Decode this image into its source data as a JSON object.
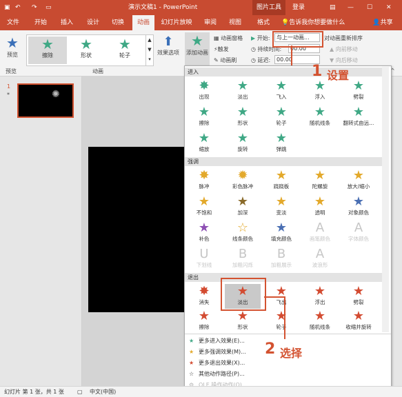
{
  "titlebar": {
    "title": "演示文稿1 - PowerPoint",
    "context": "图片工具",
    "login": "登录"
  },
  "tabs": [
    "文件",
    "开始",
    "插入",
    "设计",
    "切换",
    "动画",
    "幻灯片放映",
    "审阅",
    "视图",
    "格式"
  ],
  "tell_me": "告诉我你想要做什么",
  "share": "共享",
  "ribbon": {
    "preview": "预览",
    "preview_group": "预览",
    "gallery": [
      "擦除",
      "形状",
      "轮子"
    ],
    "effect_options": "效果选项",
    "animation_group": "动画",
    "add_animation": "添加动画",
    "anim_pane": "动画窗格",
    "trigger": "触发",
    "anim_painter": "动画刷",
    "start_label": "开始:",
    "start_value": "与上一动画...",
    "duration_label": "持续时间:",
    "duration_value": "00.00",
    "delay_label": "延迟:",
    "delay_value": "00.00",
    "reorder": "对动画重新排序",
    "move_earlier": "向前移动",
    "move_later": "向后移动"
  },
  "thumb": {
    "number": "1",
    "mark": "*"
  },
  "sections": {
    "enter": "进入",
    "emph": "强调",
    "exit": "退出"
  },
  "enter": [
    "出现",
    "淡出",
    "飞入",
    "浮入",
    "劈裂",
    "擦除",
    "形状",
    "轮子",
    "随机线条",
    "翻转式由远...",
    "缩放",
    "旋转",
    "弹跳"
  ],
  "emph": [
    "脉冲",
    "彩色脉冲",
    "跷跷板",
    "陀螺旋",
    "放大/缩小",
    "不饱和",
    "加深",
    "变淡",
    "透明",
    "对象颜色",
    "补色",
    "线条颜色",
    "填充颜色",
    "画笔颜色",
    "字体颜色",
    "下划线",
    "加粗闪烁",
    "加粗展示",
    "波浪形"
  ],
  "exit": [
    "消失",
    "淡出",
    "飞出",
    "浮出",
    "劈裂",
    "擦除",
    "形状",
    "轮子",
    "随机线条",
    "收缩并旋转"
  ],
  "more": [
    "更多进入效果(E)...",
    "更多强调效果(M)...",
    "更多退出效果(X)...",
    "其他动作路径(P)...",
    "OLE 操作动作(O)..."
  ],
  "annotations": {
    "one": "1",
    "set": "设置",
    "two": "2",
    "choose": "选择"
  },
  "status": {
    "slide": "幻灯片 第 1 张，共 1 张",
    "lang": "中文(中国)"
  }
}
